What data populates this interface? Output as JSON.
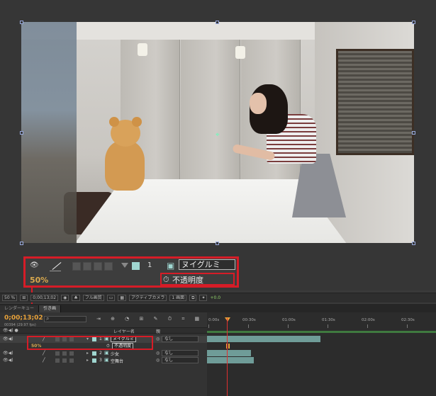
{
  "callout": {
    "layer_number": "1",
    "layer_name": "ヌイグルミ",
    "opacity_value": "50%",
    "property_name": "不透明度"
  },
  "viewer_bar": {
    "zoom": "50 %",
    "timecode": "0;00;13;02",
    "resolution": "フル画質",
    "camera": "アクティブカメラ",
    "views": "1 画面",
    "exposure": "+0.0"
  },
  "tabs": [
    {
      "label": "レンダーキュー"
    },
    {
      "label": "引き画"
    }
  ],
  "timeline": {
    "timecode": "0;00;13;02",
    "fps": "00394 (29.97 fps)",
    "column_layer_name": "レイヤー名",
    "column_parent": "親",
    "ruler_labels": [
      "0:00s",
      "00:30s",
      "01:00s",
      "01:30s",
      "02:00s",
      "02:30s"
    ],
    "layers": [
      {
        "index": "1",
        "name": "ヌイグルミ",
        "parent": "なし"
      },
      {
        "index": "2",
        "name": "少女",
        "parent": "なし"
      },
      {
        "index": "3",
        "name": "空舞台",
        "parent": "なし"
      }
    ],
    "sub_property": "不透明度",
    "sub_value": "50%"
  }
}
